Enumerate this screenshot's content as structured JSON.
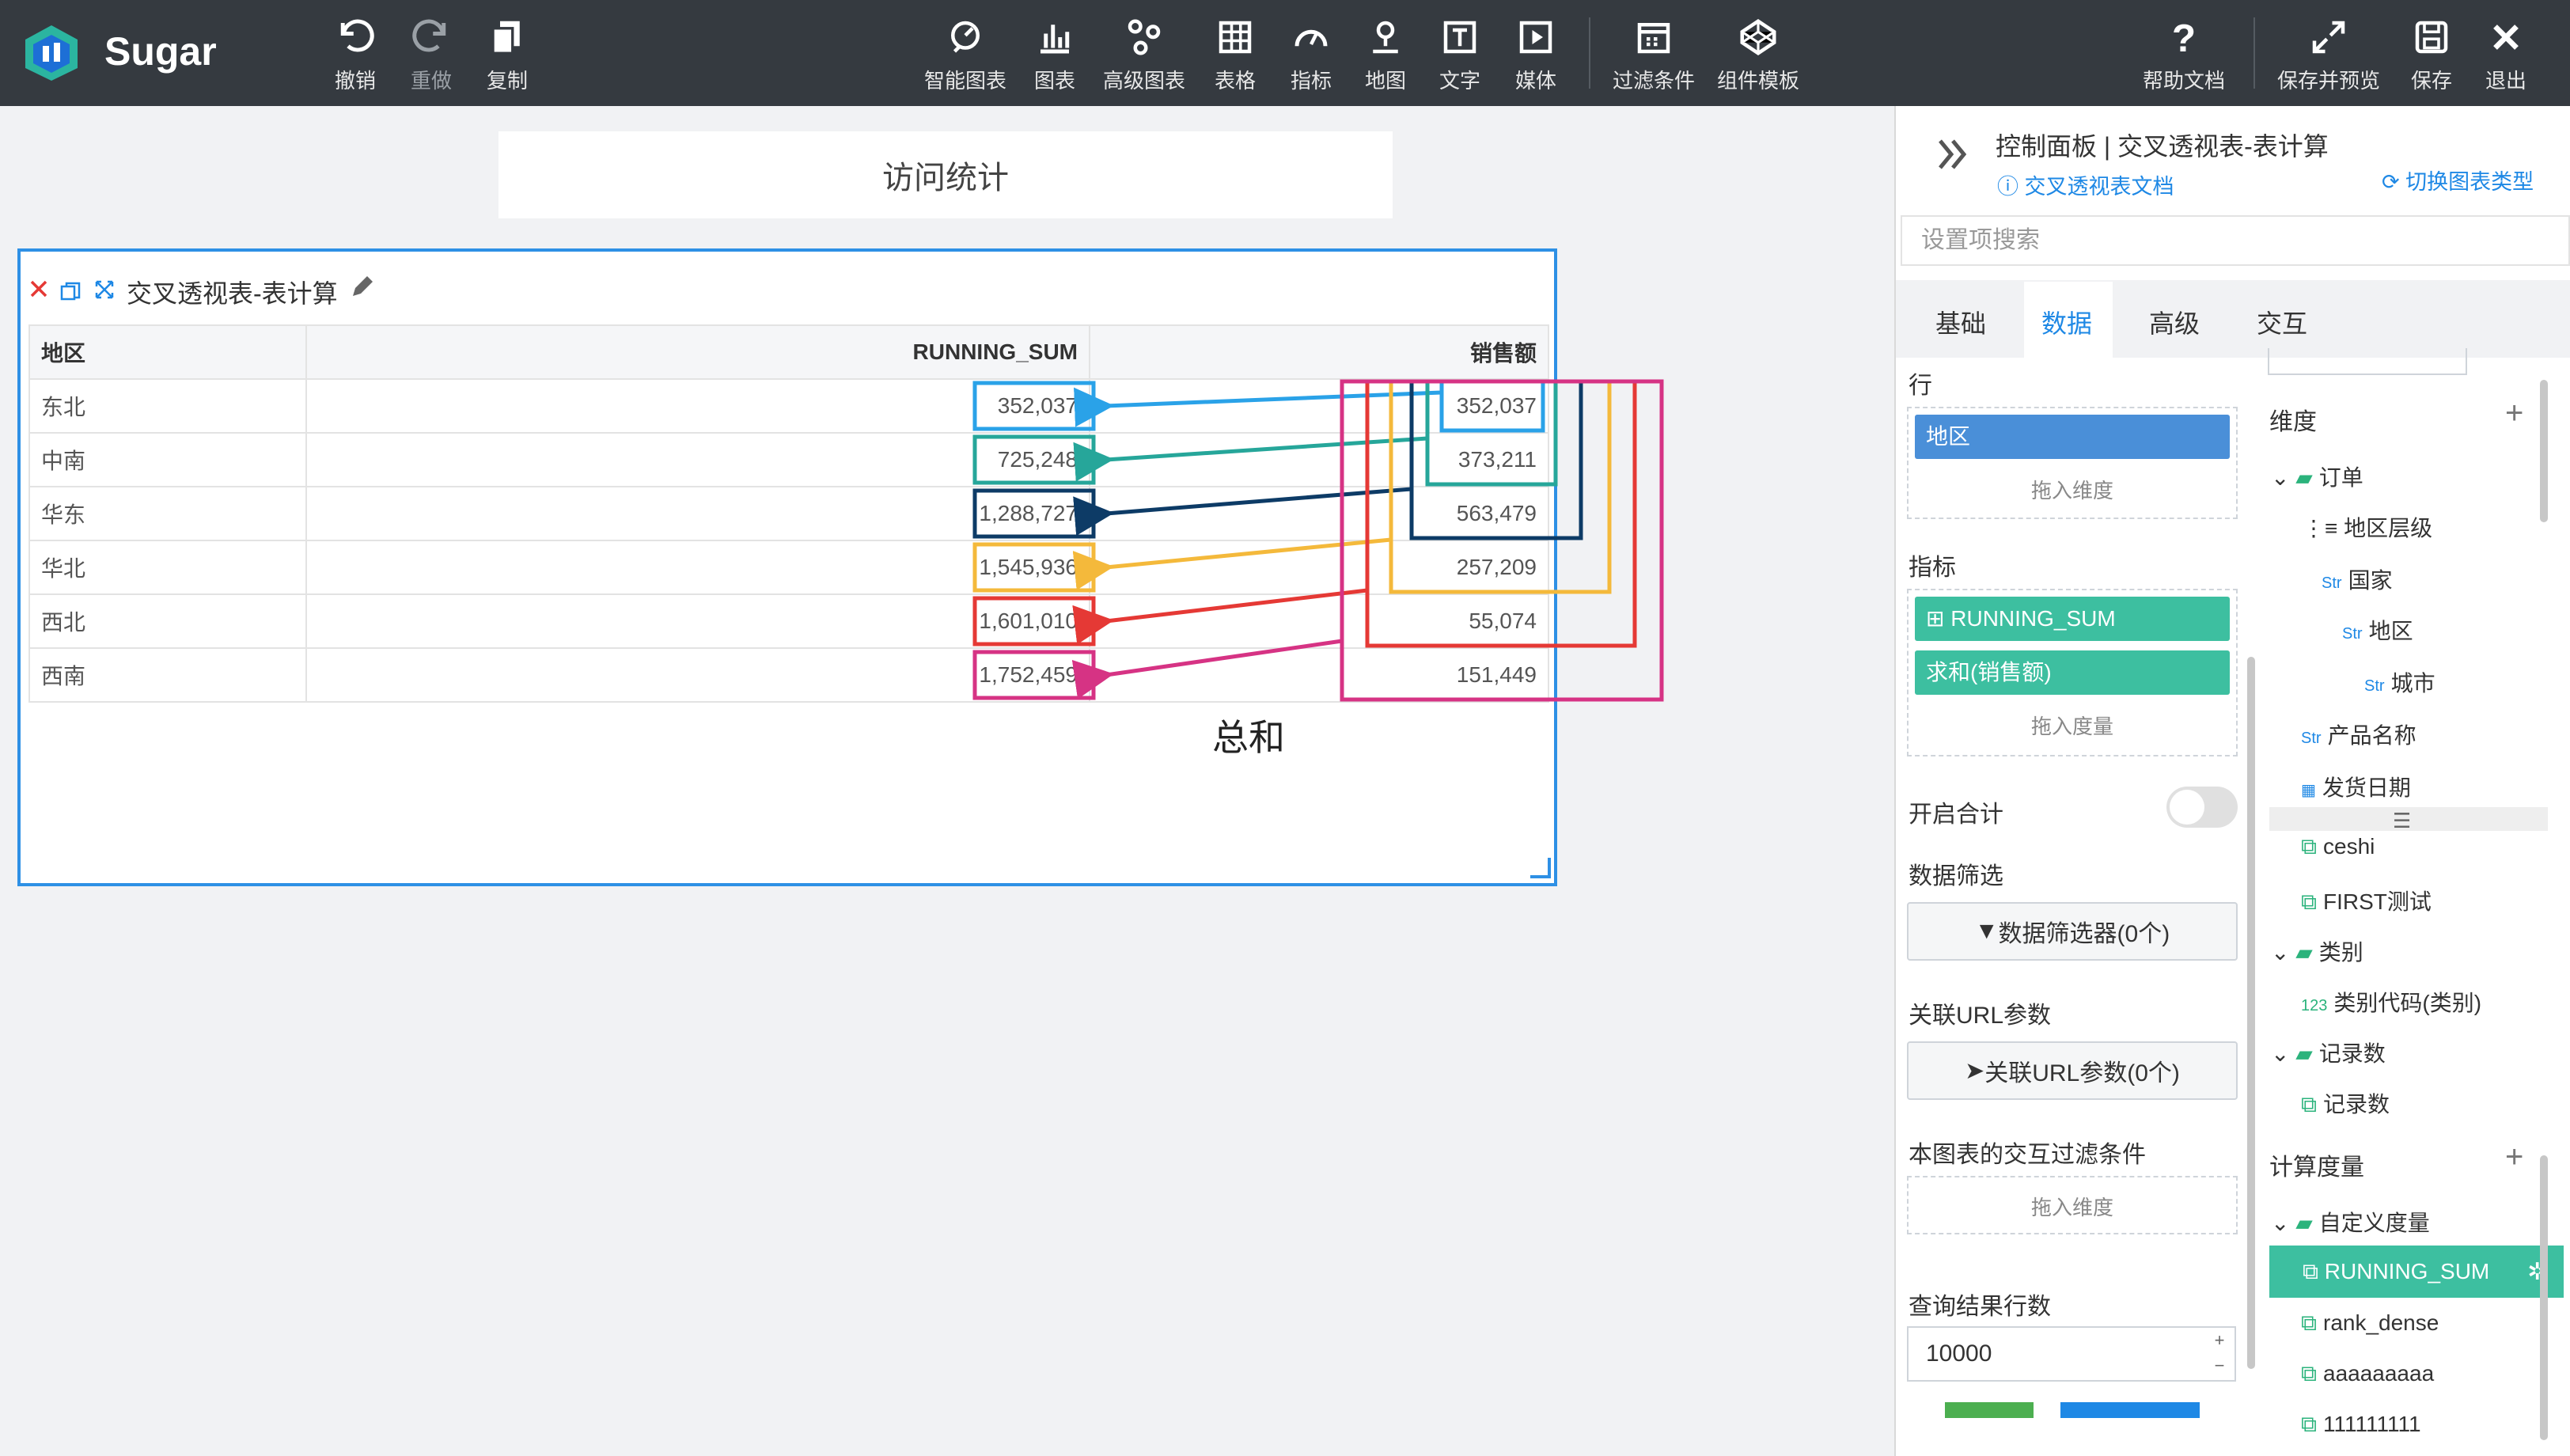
{
  "app": {
    "name": "Sugar"
  },
  "toolbar": {
    "left": [
      {
        "label": "撤销",
        "icon": "undo-icon"
      },
      {
        "label": "重做",
        "icon": "redo-icon"
      },
      {
        "label": "复制",
        "icon": "copy-icon"
      }
    ],
    "center": [
      {
        "label": "智能图表"
      },
      {
        "label": "图表"
      },
      {
        "label": "高级图表"
      },
      {
        "label": "表格"
      },
      {
        "label": "指标"
      },
      {
        "label": "地图"
      },
      {
        "label": "文字"
      },
      {
        "label": "媒体"
      },
      {
        "label": "过滤条件"
      },
      {
        "label": "组件模板"
      }
    ],
    "right": [
      {
        "label": "帮助文档"
      },
      {
        "label": "保存并预览"
      },
      {
        "label": "保存"
      },
      {
        "label": "退出"
      }
    ]
  },
  "canvas": {
    "title": "访问统计",
    "widget_title": "交叉透视表-表计算",
    "table": {
      "headers": [
        "地区",
        "RUNNING_SUM",
        "销售额"
      ],
      "rows": [
        [
          "东北",
          "352,037",
          "352,037"
        ],
        [
          "中南",
          "725,248",
          "373,211"
        ],
        [
          "华东",
          "1,288,727",
          "563,479"
        ],
        [
          "华北",
          "1,545,936",
          "257,209"
        ],
        [
          "西北",
          "1,601,010",
          "55,074"
        ],
        [
          "西南",
          "1,752,459",
          "151,449"
        ]
      ]
    },
    "annotation": "总和",
    "colors": [
      "#2aa2e8",
      "#26a69a",
      "#0d3b66",
      "#f4b93b",
      "#e53935",
      "#d63384"
    ]
  },
  "panel": {
    "title": "控制面板 | 交叉透视表-表计算",
    "doc_link": "交叉透视表文档",
    "switch_link": "切换图表类型",
    "search_placeholder": "设置项搜索",
    "tabs": [
      "基础",
      "数据",
      "高级",
      "交互"
    ],
    "active_tab": "数据",
    "row_label": "行",
    "row_pill": "地区",
    "drag_dim": "拖入维度",
    "metric_label": "指标",
    "metric_pills": [
      "RUNNING_SUM",
      "求和(销售额)"
    ],
    "drag_measure": "拖入度量",
    "total_label": "开启合计",
    "filter_label": "数据筛选",
    "filter_btn": "数据筛选器(0个)",
    "url_label": "关联URL参数",
    "url_btn": "关联URL参数(0个)",
    "inter_label": "本图表的交互过滤条件",
    "drag_dim2": "拖入维度",
    "rows_label": "查询结果行数",
    "rows_value": "10000",
    "dim_title": "维度",
    "calc_title": "计算度量",
    "tree": [
      {
        "text": "订单",
        "type": "folder"
      },
      {
        "text": "地区层级",
        "type": "hier"
      },
      {
        "text": "国家",
        "type": "str"
      },
      {
        "text": "地区",
        "type": "str"
      },
      {
        "text": "城市",
        "type": "str"
      },
      {
        "text": "产品名称",
        "type": "str"
      },
      {
        "text": "发货日期",
        "type": "date"
      },
      {
        "text": "ceshi",
        "type": "calc"
      },
      {
        "text": "FIRST测试",
        "type": "calc"
      },
      {
        "text": "类别",
        "type": "folder"
      },
      {
        "text": "类别代码(类别)",
        "type": "num",
        "prefix": "123"
      },
      {
        "text": "记录数",
        "type": "folder"
      },
      {
        "text": "记录数",
        "type": "calc"
      }
    ],
    "calc_tree": [
      {
        "text": "自定义度量",
        "type": "folder"
      },
      {
        "text": "RUNNING_SUM",
        "type": "calc",
        "selected": true
      },
      {
        "text": "rank_dense",
        "type": "calc"
      },
      {
        "text": "aaaaaaaaa",
        "type": "calc"
      },
      {
        "text": "111111111",
        "type": "calc"
      }
    ],
    "str_tag": "Str"
  }
}
